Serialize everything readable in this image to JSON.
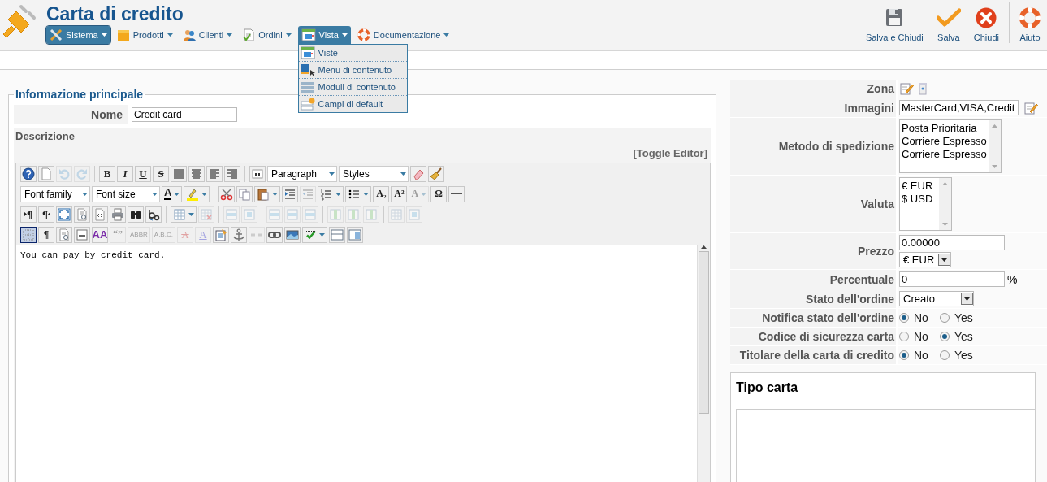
{
  "header": {
    "title": "Carta di credito"
  },
  "menu": [
    {
      "label": "Sistema",
      "kind": "tools",
      "selected": true,
      "expanded": false
    },
    {
      "label": "Prodotti",
      "kind": "box",
      "selected": false,
      "expanded": false
    },
    {
      "label": "Clienti",
      "kind": "people",
      "selected": false,
      "expanded": false
    },
    {
      "label": "Ordini",
      "kind": "document",
      "selected": false,
      "expanded": false
    },
    {
      "label": "Vista",
      "kind": "window",
      "selected": false,
      "expanded": true,
      "items": [
        {
          "label": "Viste",
          "kind": "window"
        },
        {
          "label": "Menu di contenuto",
          "kind": "pointer"
        },
        {
          "label": "Moduli di contenuto",
          "kind": "bars"
        },
        {
          "label": "Campi di default",
          "kind": "fields"
        }
      ]
    },
    {
      "label": "Documentazione",
      "kind": "lifebuoy",
      "selected": false,
      "expanded": false
    }
  ],
  "toolbar": [
    {
      "label": "Salva e Chiudi",
      "kind": "floppy"
    },
    {
      "label": "Salva",
      "kind": "check"
    },
    {
      "label": "Chiudi",
      "kind": "close"
    },
    {
      "label": "Aiuto",
      "kind": "lifebuoy"
    }
  ],
  "main": {
    "legend": "Informazione principale",
    "name_label": "Nome",
    "name_value": "Credit card",
    "description_label": "Descrizione",
    "toggle_editor": "[Toggle Editor]",
    "editor": {
      "content": "You can pay by credit card.",
      "toolbar_rows": [
        {
          "items": [
            {
              "kind": "help",
              "disabled": false,
              "active": false
            },
            {
              "kind": "new-document",
              "disabled": false,
              "active": false
            },
            {
              "kind": "undo",
              "disabled": true,
              "active": false
            },
            {
              "kind": "redo",
              "disabled": true,
              "active": false
            },
            {
              "kind": "sep"
            },
            {
              "kind": "bold",
              "glyph": "B",
              "disabled": false,
              "active": false
            },
            {
              "kind": "italic",
              "glyph": "I",
              "disabled": false,
              "active": false
            },
            {
              "kind": "underline",
              "glyph": "U",
              "disabled": false,
              "active": false
            },
            {
              "kind": "strike",
              "glyph": "S",
              "disabled": false,
              "active": false
            },
            {
              "kind": "justify",
              "disabled": false,
              "active": false
            },
            {
              "kind": "center",
              "disabled": false,
              "active": false
            },
            {
              "kind": "left",
              "disabled": false,
              "active": false
            },
            {
              "kind": "right",
              "disabled": false,
              "active": false
            },
            {
              "kind": "sep"
            },
            {
              "kind": "quote",
              "disabled": false,
              "active": false
            },
            {
              "kind": "select",
              "value": "Paragraph"
            },
            {
              "kind": "select",
              "value": "Styles"
            },
            {
              "kind": "eraser",
              "disabled": false,
              "active": false
            },
            {
              "kind": "broom",
              "disabled": false,
              "active": false
            }
          ]
        },
        {
          "items": [
            {
              "kind": "select",
              "value": "Font family"
            },
            {
              "kind": "select",
              "value": "Font size"
            },
            {
              "kind": "text-color",
              "glyph": "A",
              "dropdown": true,
              "disabled": false,
              "active": false
            },
            {
              "kind": "highlight",
              "dropdown": true,
              "disabled": false,
              "active": false
            },
            {
              "kind": "sep"
            },
            {
              "kind": "cut",
              "disabled": false,
              "active": false
            },
            {
              "kind": "copy",
              "disabled": false,
              "active": false
            },
            {
              "kind": "paste",
              "dropdown": true,
              "disabled": false,
              "active": false
            },
            {
              "kind": "indent",
              "disabled": false,
              "active": false
            },
            {
              "kind": "outdent",
              "disabled": true,
              "active": false
            },
            {
              "kind": "numbered-list",
              "dropdown": true,
              "disabled": false,
              "active": false
            },
            {
              "kind": "bulleted-list",
              "dropdown": true,
              "disabled": false,
              "active": false
            },
            {
              "kind": "glyph",
              "glyph": "A₂",
              "disabled": false,
              "active": false
            },
            {
              "kind": "glyph",
              "glyph": "A²",
              "disabled": false,
              "active": false
            },
            {
              "kind": "glyph",
              "glyph": "A",
              "dropdown": true,
              "disabled": true,
              "active": false
            },
            {
              "kind": "glyph",
              "glyph": "Ω",
              "disabled": false,
              "active": false
            },
            {
              "kind": "rule",
              "disabled": false,
              "active": false
            }
          ]
        },
        {
          "items": [
            {
              "kind": "ltr",
              "glyph": "¶",
              "disabled": false,
              "active": false
            },
            {
              "kind": "rtl",
              "glyph": "¶",
              "disabled": false,
              "active": false
            },
            {
              "kind": "fullscreen",
              "disabled": false,
              "active": false
            },
            {
              "kind": "preview",
              "disabled": false,
              "active": false
            },
            {
              "kind": "code",
              "disabled": false,
              "active": false
            },
            {
              "kind": "print",
              "disabled": false,
              "active": false
            },
            {
              "kind": "binoculars",
              "disabled": false,
              "active": false
            },
            {
              "kind": "replace",
              "disabled": false,
              "active": false
            },
            {
              "kind": "sep"
            },
            {
              "kind": "table",
              "dropdown": true,
              "disabled": false,
              "active": false
            },
            {
              "kind": "table-delete",
              "disabled": true,
              "active": false
            },
            {
              "kind": "sep"
            },
            {
              "kind": "table-row",
              "disabled": true,
              "active": false
            },
            {
              "kind": "table-cell",
              "disabled": true,
              "active": false
            },
            {
              "kind": "sep"
            },
            {
              "kind": "table-row",
              "disabled": true,
              "active": false
            },
            {
              "kind": "table-row",
              "disabled": true,
              "active": false
            },
            {
              "kind": "table-row",
              "disabled": true,
              "active": false
            },
            {
              "kind": "sep"
            },
            {
              "kind": "table-column",
              "disabled": true,
              "active": false
            },
            {
              "kind": "table-column",
              "disabled": true,
              "active": false
            },
            {
              "kind": "table-column",
              "disabled": true,
              "active": false
            },
            {
              "kind": "sep"
            },
            {
              "kind": "table",
              "disabled": true,
              "active": false
            },
            {
              "kind": "table-cell",
              "disabled": true,
              "active": false
            }
          ]
        },
        {
          "items": [
            {
              "kind": "grid",
              "disabled": false,
              "active": true
            },
            {
              "kind": "glyph",
              "glyph": "¶",
              "disabled": false,
              "active": false
            },
            {
              "kind": "preview",
              "disabled": false,
              "active": false
            },
            {
              "kind": "page-break",
              "disabled": false,
              "active": false
            },
            {
              "kind": "styles",
              "glyph": "AA",
              "disabled": false,
              "active": false
            },
            {
              "kind": "glyph",
              "glyph": "“”",
              "disabled": true,
              "active": false
            },
            {
              "kind": "small-text",
              "glyph": "ABBR",
              "disabled": true,
              "active": false
            },
            {
              "kind": "small-text",
              "glyph": "A.B.C.",
              "disabled": true,
              "active": false
            },
            {
              "kind": "struck",
              "glyph": "A",
              "disabled": true,
              "active": false
            },
            {
              "kind": "underlined",
              "glyph": "A",
              "disabled": true,
              "active": false
            },
            {
              "kind": "attributes",
              "disabled": false,
              "active": false
            },
            {
              "kind": "anchor",
              "disabled": false,
              "active": false
            },
            {
              "kind": "unlink",
              "disabled": true,
              "active": false
            },
            {
              "kind": "link",
              "disabled": false,
              "active": false
            },
            {
              "kind": "image",
              "disabled": false,
              "active": false
            },
            {
              "kind": "spellcheck",
              "dropdown": true,
              "disabled": false,
              "active": false
            },
            {
              "kind": "template",
              "disabled": false,
              "active": false
            },
            {
              "kind": "layer",
              "disabled": false,
              "active": false
            }
          ]
        }
      ]
    }
  },
  "details": {
    "rows": [
      {
        "label": "Zona",
        "kind": "icons"
      },
      {
        "label": "Immagini",
        "kind": "text-edit",
        "value": "MasterCard,VISA,Credit"
      },
      {
        "label": "Metodo di spedizione",
        "kind": "listbox",
        "options": [
          "Posta Prioritaria",
          "Corriere Espresso",
          "Corriere Espresso"
        ]
      },
      {
        "label": "Valuta",
        "kind": "listbox",
        "options": [
          "€ EUR",
          "$ USD"
        ]
      },
      {
        "label": "Prezzo",
        "kind": "price",
        "value": "0.00000",
        "currency": "€ EUR"
      },
      {
        "label": "Percentuale",
        "kind": "percent",
        "value": "0",
        "unit": "%"
      },
      {
        "label": "Stato dell'ordine",
        "kind": "select",
        "value": "Creato"
      },
      {
        "label": "Notifica stato dell'ordine",
        "kind": "radio",
        "options": [
          {
            "label": "No",
            "selected": true
          },
          {
            "label": "Yes",
            "selected": false
          }
        ]
      },
      {
        "label": "Codice di sicurezza carta",
        "kind": "radio",
        "options": [
          {
            "label": "No",
            "selected": false
          },
          {
            "label": "Yes",
            "selected": true
          }
        ]
      },
      {
        "label": "Titolare della carta di credito",
        "kind": "radio",
        "options": [
          {
            "label": "No",
            "selected": true
          },
          {
            "label": "Yes",
            "selected": false
          }
        ]
      }
    ]
  },
  "card_type": {
    "title": "Tipo carta"
  }
}
